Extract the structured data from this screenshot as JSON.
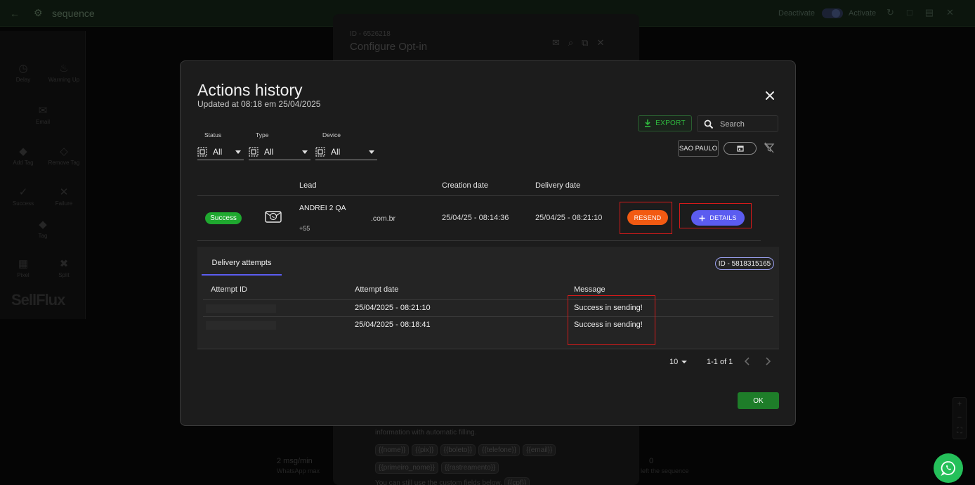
{
  "background": {
    "app_title": "sequence",
    "deactivate_label": "Deactivate",
    "activate_label": "Activate",
    "left_panel_items": [
      "Delay",
      "Warming Up",
      "Email",
      "Add Tag",
      "Remove Tag",
      "Success",
      "Failure",
      "Tag",
      "Pixel",
      "Split"
    ],
    "logo_text": "SellFlux",
    "config_modal": {
      "id_label": "ID - 6526218",
      "title": "Configure Opt-in",
      "notification_count": "1",
      "info_text": "information with automatic filling.",
      "chips": [
        "{{nome}}",
        "{{pix}}",
        "{{boleto}}",
        "{{telefone}}",
        "{{email}}",
        "{{primeiro_nome}}",
        "{{rastreamento}}"
      ],
      "custom_text": "You can still use the custom fields below.",
      "custom_chip": "{{cpf}}"
    },
    "rate_label": "2 msg/min",
    "rate_sub": "WhatsApp max",
    "zero_label": "0",
    "zero_sub": "left the sequence"
  },
  "modal": {
    "title": "Actions history",
    "subtitle": "Updated at 08:18 em 25/04/2025",
    "export_label": "EXPORT",
    "search_placeholder": "Search",
    "timezone_label": "SAO PAULO",
    "filters": [
      {
        "label": "Status",
        "value": "All"
      },
      {
        "label": "Type",
        "value": "All"
      },
      {
        "label": "Device",
        "value": "All"
      }
    ],
    "columns": {
      "lead": "Lead",
      "creation": "Creation date",
      "delivery": "Delivery date"
    },
    "row": {
      "status": "Success",
      "device_icon": "whatsapp-message-icon",
      "lead_name": "ANDREI 2 QA",
      "lead_phone": "+55",
      "lead_email": ".com.br",
      "creation_date": "25/04/25 - 08:14:36",
      "delivery_date": "25/04/25 - 08:21:10",
      "resend_label": "RESEND",
      "details_label": "DETAILS"
    },
    "attempts": {
      "tab_label": "Delivery attempts",
      "id_label": "ID - 5818315165",
      "columns": {
        "attempt_id": "Attempt ID",
        "attempt_date": "Attempt date",
        "message": "Message"
      },
      "rows": [
        {
          "date": "25/04/2025 - 08:21:10",
          "message": "Success in sending!"
        },
        {
          "date": "25/04/2025 - 08:18:41",
          "message": "Success in sending!"
        }
      ]
    },
    "pagination": {
      "page_size": "10",
      "range": "1-1 of 1"
    },
    "ok_label": "OK"
  },
  "colors": {
    "success": "#1fa82f",
    "resend": "#f25a12",
    "details": "#5b5cf0",
    "ok": "#1e7d29",
    "whatsapp": "#25c05a"
  }
}
